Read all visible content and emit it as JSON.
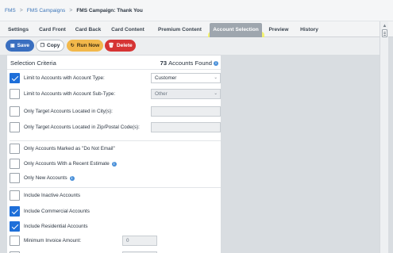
{
  "breadcrumb": {
    "items": [
      "FMS",
      "FMS Campaigns",
      "FMS Campaign: Thank You"
    ],
    "separator": ">"
  },
  "tabs": [
    "Settings",
    "Card Front",
    "Card Back",
    "Card Content",
    "Premium Content",
    "Account Selection",
    "Preview",
    "History"
  ],
  "active_tab": "Account Selection",
  "actions": {
    "save": "Save",
    "copy": "Copy",
    "run_now": "Run Now",
    "delete": "Delete"
  },
  "panel": {
    "title": "Selection Criteria",
    "count": "73",
    "count_label": "Accounts Found"
  },
  "criteria": {
    "account_type": {
      "label": "Limit to Accounts with Account Type:",
      "checked": true,
      "value": "Customer"
    },
    "account_subtype": {
      "label": "Limit to Accounts with Account Sub-Type:",
      "checked": false,
      "value": "Other"
    },
    "city": {
      "label": "Only Target Accounts Located in City(s):",
      "checked": false,
      "value": ""
    },
    "zip": {
      "label": "Only Target Accounts Located in Zip/Postal Code(s):",
      "checked": false,
      "value": ""
    },
    "do_not_email": {
      "label": "Only Accounts Marked as \"Do Not Email\"",
      "checked": false
    },
    "recent_estimate": {
      "label": "Only Accounts With a Recent Estimate",
      "checked": false
    },
    "new_accounts": {
      "label": "Only New Accounts",
      "checked": false
    },
    "inactive": {
      "label": "Include Inactive Accounts",
      "checked": false
    },
    "commercial": {
      "label": "Include Commercial Accounts",
      "checked": true
    },
    "residential": {
      "label": "Include Residential Accounts",
      "checked": true
    },
    "min_invoice": {
      "label": "Minimum Invoice Amount:",
      "checked": false,
      "value": "0"
    }
  },
  "colors": {
    "accent": "#1e6fd9",
    "save": "#3a6fc0",
    "run_now": "#f2b84b",
    "delete": "#d63434",
    "active_tab": "#9ea6ae",
    "highlight": "#f3f25a"
  }
}
